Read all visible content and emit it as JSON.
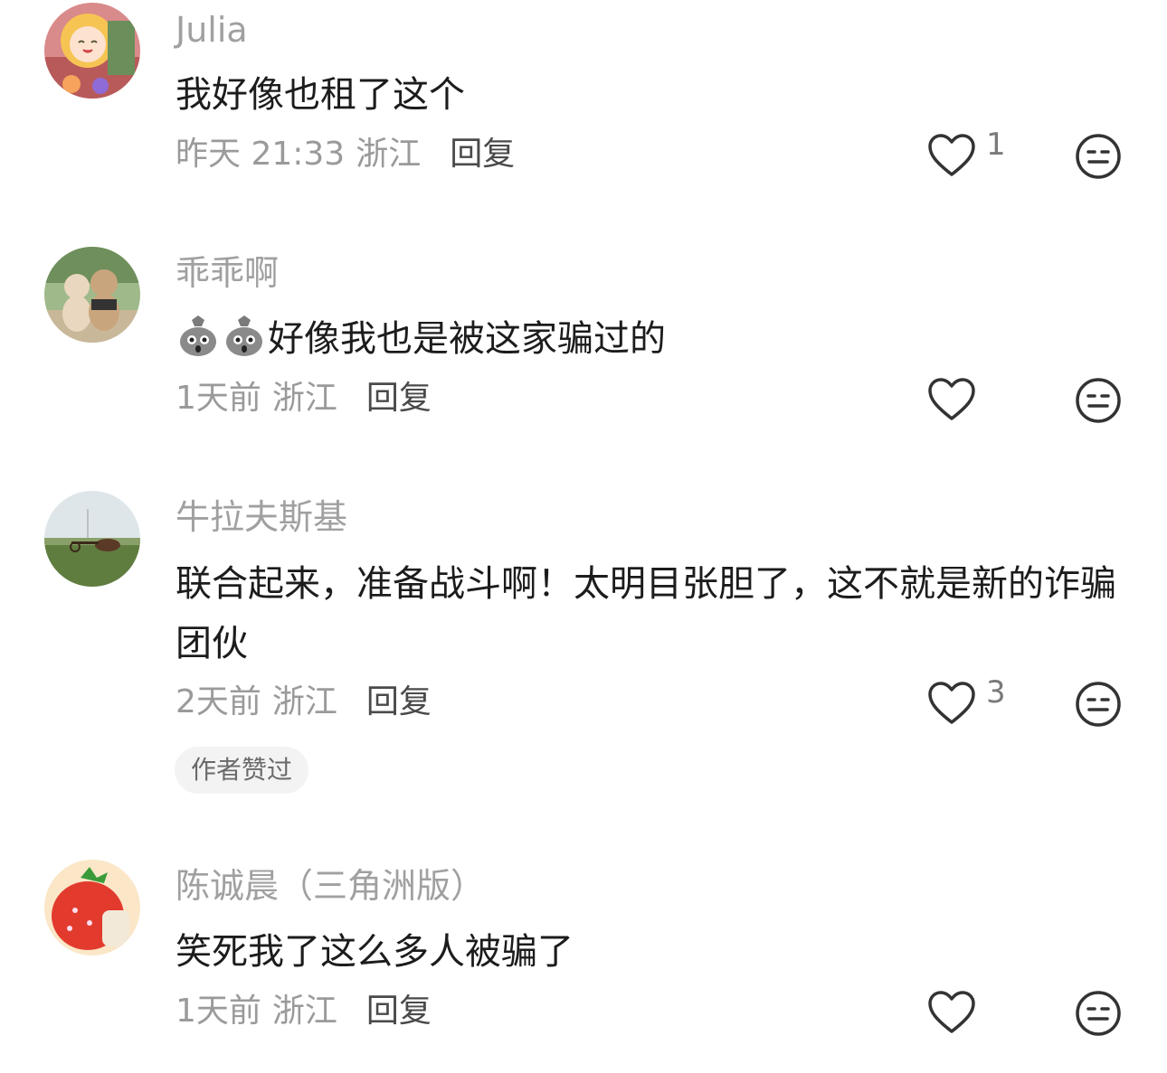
{
  "comments": [
    {
      "username": "Julia",
      "content": "我好像也租了这个",
      "time": "昨天 21:33",
      "location": "浙江",
      "reply_label": "回复",
      "likes": "1"
    },
    {
      "username": "乖乖啊",
      "content": "好像我也是被这家骗过的",
      "emoji_icons": [
        "money-bag-emoji-icon",
        "money-bag-emoji-icon"
      ],
      "time": "1天前",
      "location": "浙江",
      "reply_label": "回复",
      "likes": ""
    },
    {
      "username": "牛拉夫斯基",
      "content": "联合起来，准备战斗啊！太明目张胆了，这不就是新的诈骗团伙",
      "time": "2天前",
      "location": "浙江",
      "reply_label": "回复",
      "likes": "3",
      "badge": "作者赞过"
    },
    {
      "username": "陈诚晨（三角洲版）",
      "content": "笑死我了这么多人被骗了",
      "time": "1天前",
      "location": "浙江",
      "reply_label": "回复",
      "likes": ""
    }
  ],
  "icons": {
    "like": "heart-outline-icon",
    "dislike": "expressionless-face-icon"
  },
  "colors": {
    "username": "#a0a0a0",
    "content": "#1c1c1c",
    "meta": "#9a9a9a",
    "reply": "#4a4a4a",
    "icon_stroke": "#333333",
    "badge_bg": "#f3f3f3"
  }
}
